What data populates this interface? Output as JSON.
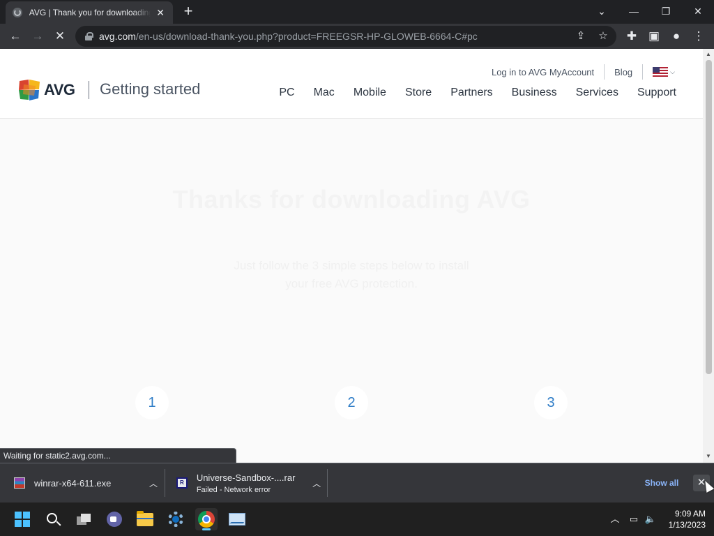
{
  "browser": {
    "tab_title": "AVG | Thank you for downloading",
    "tab_close": "✕",
    "new_tab": "+",
    "url_host": "avg.com",
    "url_path": "/en-us/download-thank-you.php?product=FREEGSR-HP-GLOWEB-6664-C#pc",
    "status_text": "Waiting for static2.avg.com...",
    "icons": [
      "back-arrow-icon",
      "forward-arrow-icon",
      "stop-loading-icon",
      "lock-icon",
      "share-icon",
      "bookmark-star-icon",
      "extensions-icon",
      "side-panel-icon",
      "profile-icon",
      "menu-icon"
    ]
  },
  "site": {
    "logo_text": "AVG",
    "logo_subtitle": "Getting started",
    "top_links": {
      "login": "Log in to AVG MyAccount",
      "blog": "Blog"
    },
    "nav": [
      "PC",
      "Mac",
      "Mobile",
      "Store",
      "Partners",
      "Business",
      "Services",
      "Support"
    ],
    "hero": {
      "title": "Thanks for downloading AVG",
      "subtitle_line1": "Just follow the 3 simple steps below to install",
      "subtitle_line2": "your free AVG protection."
    },
    "steps": [
      "1",
      "2",
      "3"
    ]
  },
  "downloads": {
    "items": [
      {
        "name": "winrar-x64-611.exe",
        "status": ""
      },
      {
        "name": "Universe-Sandbox-....rar",
        "status": "Failed - Network error"
      }
    ],
    "show_all": "Show all",
    "close": "✕"
  },
  "taskbar": {
    "time": "9:09 AM",
    "date": "1/13/2023",
    "apps": [
      "start-icon",
      "search-icon",
      "task-view-icon",
      "chat-icon",
      "file-explorer-icon",
      "settings-icon",
      "chrome-icon",
      "resource-monitor-icon"
    ]
  },
  "colors": {
    "chrome_dark": "#202124",
    "chrome_toolbar": "#35363a",
    "step_blue": "#2f7dc7",
    "link_blue": "#8ab4f8",
    "taskbar": "#202020"
  }
}
